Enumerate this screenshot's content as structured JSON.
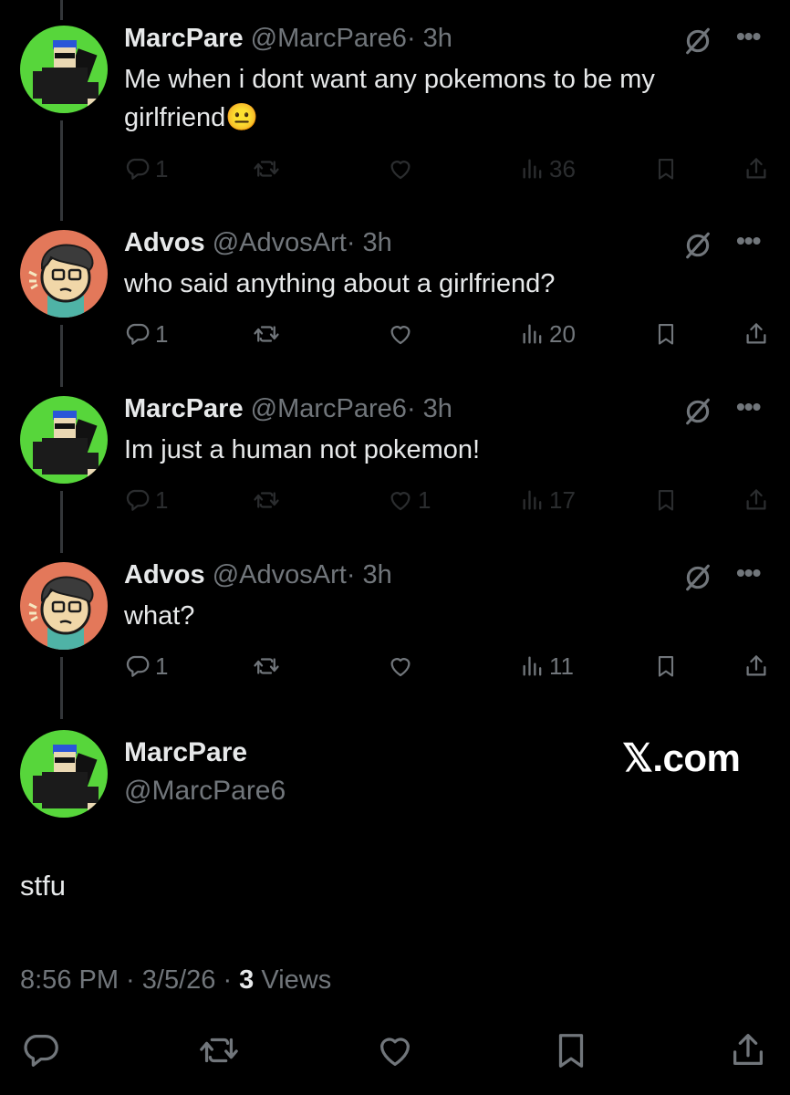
{
  "tweets": [
    {
      "name": "MarcPare",
      "handle": "@MarcPare6",
      "time": "· 3h",
      "text": "Me when i dont want any pokemons to be my girlfriend",
      "emoji": "😐",
      "replies": "1",
      "retweets": "",
      "likes": "",
      "views": "36",
      "avatar": "marcpare",
      "dimmed": true
    },
    {
      "name": "Advos",
      "handle": "@AdvosArt",
      "time": "· 3h",
      "text": "who said anything about a girlfriend?",
      "emoji": "",
      "replies": "1",
      "retweets": "",
      "likes": "",
      "views": "20",
      "avatar": "advos",
      "dimmed": false
    },
    {
      "name": "MarcPare",
      "handle": "@MarcPare6",
      "time": "· 3h",
      "text": "Im just a human not pokemon!",
      "emoji": "",
      "replies": "1",
      "retweets": "",
      "likes": "1",
      "views": "17",
      "avatar": "marcpare",
      "dimmed": true
    },
    {
      "name": "Advos",
      "handle": "@AdvosArt",
      "time": "· 3h",
      "text": "what?",
      "emoji": "",
      "replies": "1",
      "retweets": "",
      "likes": "",
      "views": "11",
      "avatar": "advos",
      "dimmed": false
    }
  ],
  "main_tweet": {
    "name": "MarcPare",
    "handle": "@MarcPare6",
    "text": "stfu",
    "time": "8:56 PM · 3/5/26 · ",
    "views_count": "3",
    "views_label": " Views",
    "watermark": "𝕏.com"
  },
  "icons": {
    "reply": "reply-icon",
    "retweet": "retweet-icon",
    "like": "heart-icon",
    "views": "views-icon",
    "bookmark": "bookmark-icon",
    "share": "share-icon",
    "grok": "slash-circle-icon",
    "more": "more-icon"
  },
  "colors": {
    "background": "#000000",
    "text": "#e7e9ea",
    "secondary": "#71767b",
    "thread_line": "#333639",
    "marc_avatar_bg": "#57d63b",
    "advos_avatar_bg": "#e3785a"
  }
}
